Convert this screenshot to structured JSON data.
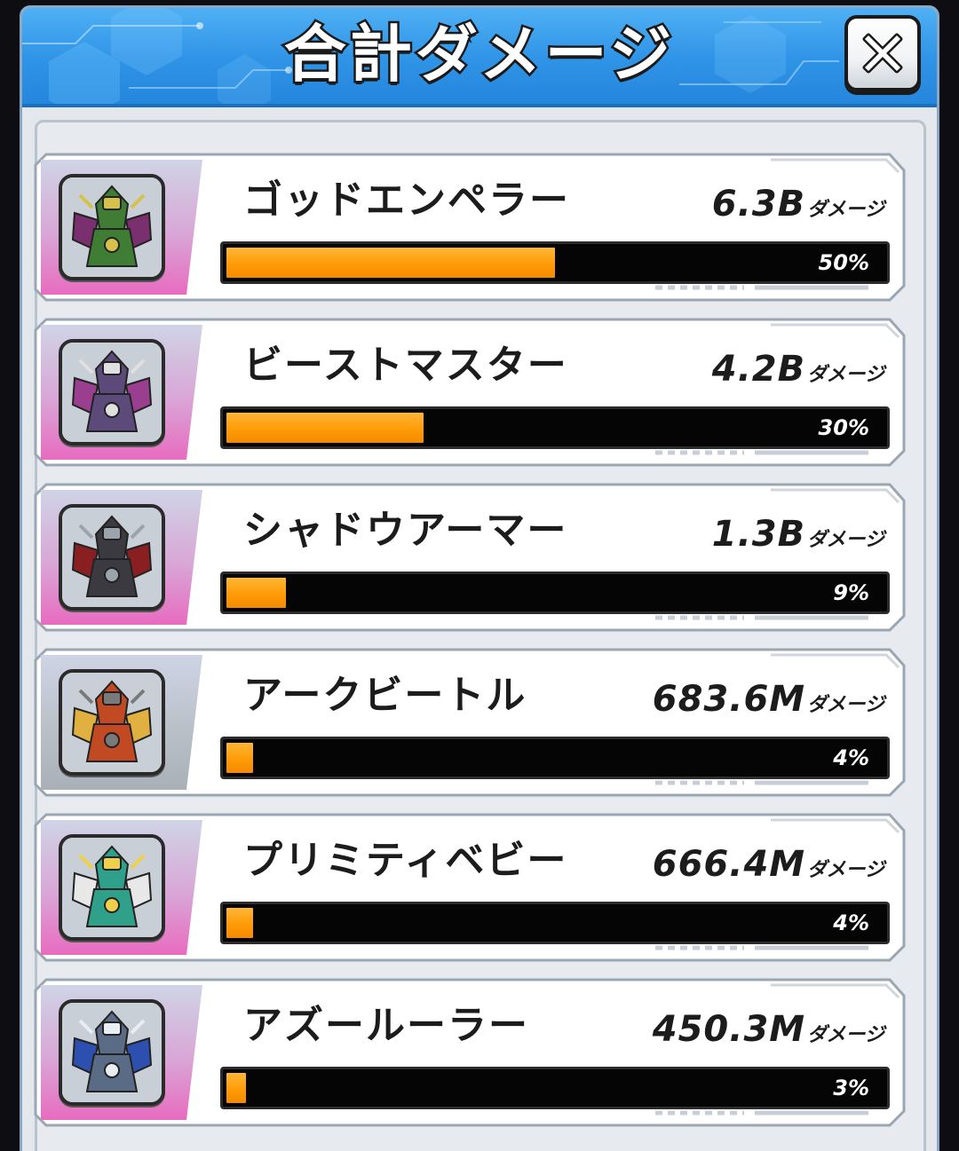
{
  "dialog": {
    "title": "合計ダメージ",
    "close_label": "close"
  },
  "colors": {
    "header": "#2f93e6",
    "bar_fill": "#ff9b07",
    "bar_track": "#050505",
    "role_pink": "#e86bc0",
    "role_gray": "#a9b0b7"
  },
  "entries": [
    {
      "name": "ゴッドエンペラー",
      "damage": "6.3B",
      "unit": "ダメージ",
      "percent_label": "50%",
      "share": 0.5,
      "accent": "pink",
      "icon": "god-emperor-portrait-icon"
    },
    {
      "name": "ビーストマスター",
      "damage": "4.2B",
      "unit": "ダメージ",
      "percent_label": "30%",
      "share": 0.3,
      "accent": "pink",
      "icon": "beast-master-portrait-icon"
    },
    {
      "name": "シャドウアーマー",
      "damage": "1.3B",
      "unit": "ダメージ",
      "percent_label": "9%",
      "share": 0.09,
      "accent": "pink",
      "icon": "shadow-armor-portrait-icon"
    },
    {
      "name": "アークビートル",
      "damage": "683.6M",
      "unit": "ダメージ",
      "percent_label": "4%",
      "share": 0.04,
      "accent": "gray",
      "icon": "arc-beetle-portrait-icon"
    },
    {
      "name": "プリミティベビー",
      "damage": "666.4M",
      "unit": "ダメージ",
      "percent_label": "4%",
      "share": 0.04,
      "accent": "pink",
      "icon": "primitive-baby-portrait-icon"
    },
    {
      "name": "アズールーラー",
      "damage": "450.3M",
      "unit": "ダメージ",
      "percent_label": "3%",
      "share": 0.03,
      "accent": "pink",
      "icon": "azure-ruler-portrait-icon"
    }
  ]
}
